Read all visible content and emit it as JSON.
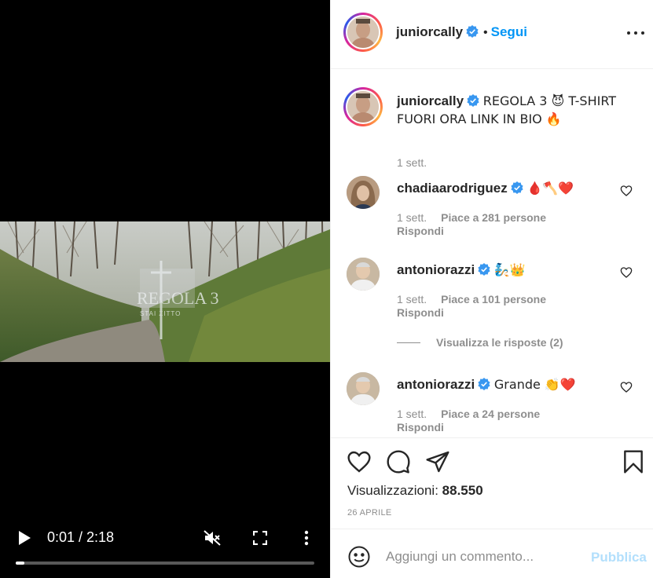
{
  "video": {
    "time_display": "0:01 / 2:18",
    "progress_fraction": 0.03,
    "overlay_title": "REGOLA 3",
    "overlay_subtitle": "STAI ZITTO"
  },
  "header": {
    "username": "juniorcally",
    "separator": "•",
    "follow_label": "Segui"
  },
  "caption": {
    "username": "juniorcally",
    "text": "REGOLA 3 😈 T-SHIRT FUORI ORA LINK IN BIO 🔥",
    "time": "1 sett."
  },
  "comments": [
    {
      "username": "chadiaarodriguez",
      "text": "🩸🪓❤️",
      "time": "1 sett.",
      "likes": "Piace a 281 persone",
      "reply_label": "Rispondi"
    },
    {
      "username": "antoniorazzi",
      "text": "🧞👑",
      "time": "1 sett.",
      "likes": "Piace a 101 persone",
      "reply_label": "Rispondi",
      "view_replies": "Visualizza le risposte (2)"
    },
    {
      "username": "antoniorazzi",
      "text": "Grande 👏❤️",
      "time": "1 sett.",
      "likes": "Piace a 24 persone",
      "reply_label": "Rispondi"
    }
  ],
  "stats": {
    "views_label": "Visualizzazioni:",
    "views_value": "88.550",
    "date": "26 APRILE"
  },
  "composer": {
    "placeholder": "Aggiungi un commento...",
    "publish_label": "Pubblica"
  },
  "icons": {
    "play": "play-icon",
    "mute": "muted-speaker-icon",
    "fullscreen": "fullscreen-icon",
    "video_more": "vertical-dots-icon",
    "verified": "verified-badge-icon",
    "more": "horizontal-dots-icon",
    "like": "heart-icon",
    "comment": "comment-bubble-icon",
    "share": "paper-plane-icon",
    "save": "bookmark-icon",
    "emoji": "smiley-icon"
  },
  "colors": {
    "accent": "#0095f6",
    "publish_disabled": "#b2dffc",
    "muted_text": "#8e8e8e",
    "verified": "#3897f0"
  }
}
